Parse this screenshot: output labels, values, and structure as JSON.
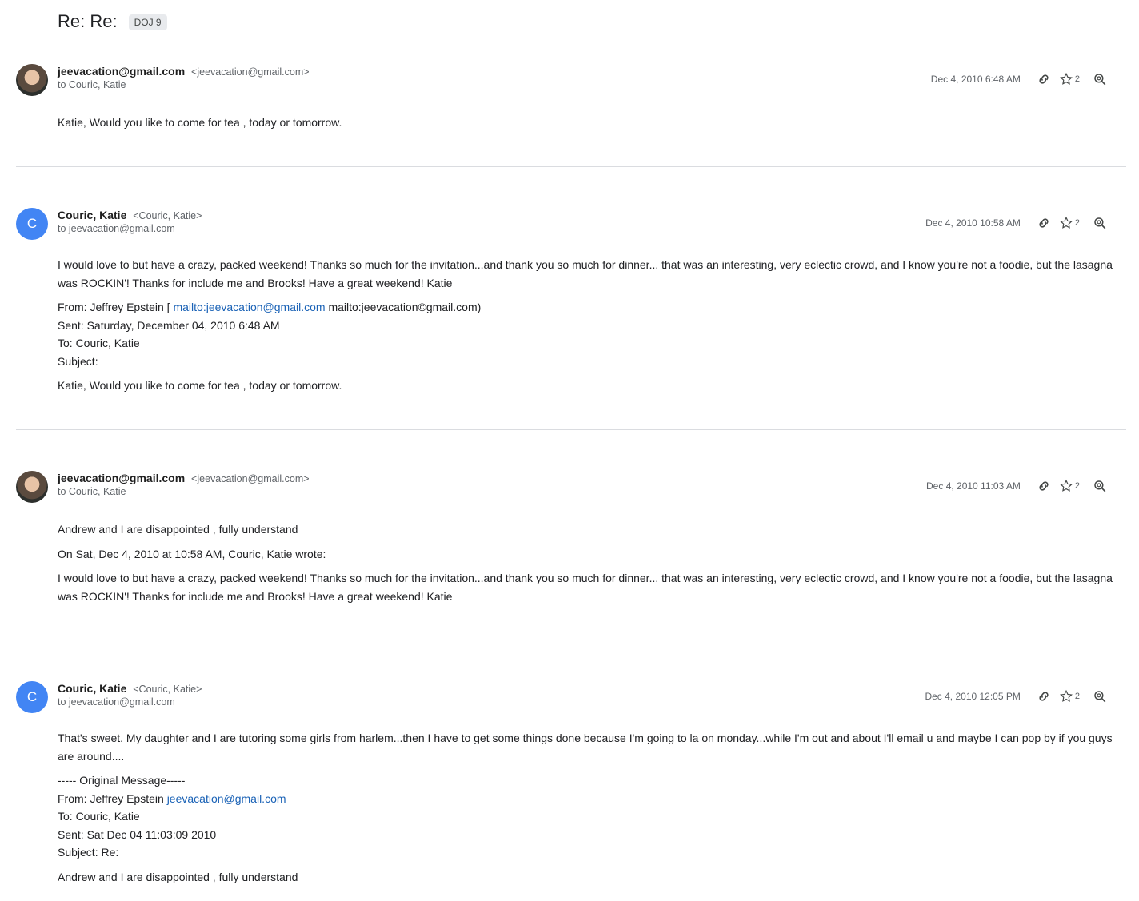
{
  "thread": {
    "subject": "Re: Re:",
    "label": "DOJ 9"
  },
  "messages": [
    {
      "sender_name": "jeevacation@gmail.com",
      "sender_addr": "<jeevacation@gmail.com>",
      "to": "to Couric, Katie",
      "date": "Dec 4, 2010 6:48 AM",
      "star_count": "2",
      "avatar_icon": "person-photo-avatar",
      "body": {
        "p1": "Katie, Would you like to come for tea , today or tomorrow."
      }
    },
    {
      "sender_name": "Couric, Katie",
      "sender_addr": "<Couric, Katie>",
      "to": "to jeevacation@gmail.com",
      "date": "Dec 4, 2010 10:58 AM",
      "star_count": "2",
      "avatar_letter": "C",
      "body": {
        "p1": "I would love to but have a crazy, packed weekend! Thanks so much for the invitation...and thank you so much for dinner... that was an interesting, very eclectic crowd, and I know you're not a foodie, but the lasagna was ROCKIN'! Thanks for include me and Brooks! Have a great weekend! Katie",
        "from_prefix": "From: Jeffrey Epstein [",
        "from_link": "mailto:jeevacation@gmail.com",
        "from_suffix": "mailto:jeevacation©gmail.com)",
        "sent": "Sent: Saturday, December 04, 2010 6:48 AM",
        "to_line": "To: Couric, Katie",
        "subject_line": "Subject:",
        "p2": "Katie, Would you like to come for tea , today or tomorrow."
      }
    },
    {
      "sender_name": "jeevacation@gmail.com",
      "sender_addr": "<jeevacation@gmail.com>",
      "to": "to Couric, Katie",
      "date": "Dec 4, 2010 11:03 AM",
      "star_count": "2",
      "avatar_icon": "person-photo-avatar",
      "body": {
        "p1": "Andrew and I are disappointed , fully understand",
        "p2": "On Sat, Dec 4, 2010 at 10:58 AM, Couric, Katie wrote:",
        "p3": "I would love to but have a crazy, packed weekend! Thanks so much for the invitation...and thank you so much for dinner... that was an interesting, very eclectic crowd, and I know you're not a foodie, but the lasagna was ROCKIN'! Thanks for include me and Brooks! Have a great weekend! Katie"
      }
    },
    {
      "sender_name": "Couric, Katie",
      "sender_addr": "<Couric, Katie>",
      "to": "to jeevacation@gmail.com",
      "date": "Dec 4, 2010 12:05 PM",
      "star_count": "2",
      "avatar_letter": "C",
      "body": {
        "p1": "That's sweet. My daughter and I are tutoring some girls from harlem...then I have to get some things done because I'm going to la on monday...while I'm out and about I'll email u and maybe I can pop by if you guys are around....",
        "orig": "----- Original Message-----",
        "from_prefix": "From: Jeffrey Epstein",
        "from_link": "jeevacation@gmail.com",
        "to_line": "To: Couric, Katie",
        "sent": "Sent: Sat Dec 04 11:03:09 2010",
        "subject_line": "Subject: Re:",
        "p2": "Andrew and I are disappointed , fully understand"
      }
    }
  ],
  "icons": {
    "link": "link-icon",
    "star": "star-icon",
    "zoom": "zoom-search-icon"
  }
}
